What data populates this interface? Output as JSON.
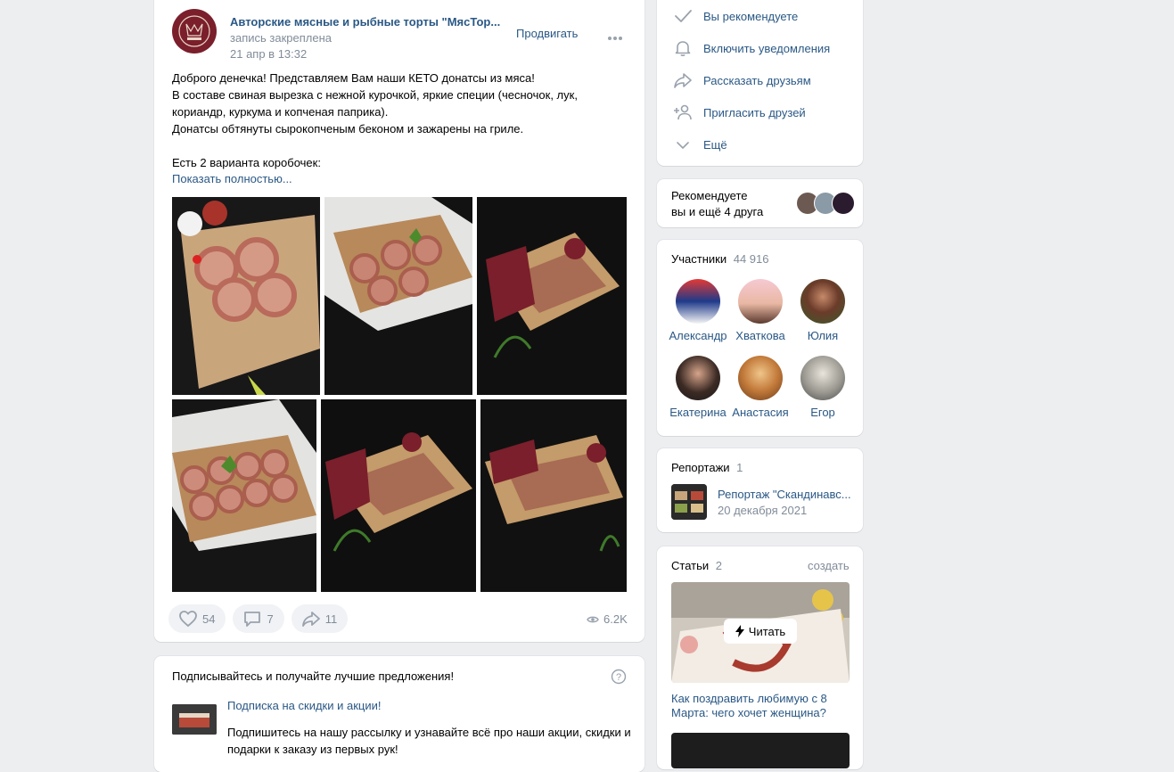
{
  "post": {
    "author": "Авторские мясные и рыбные торты \"МясТор...",
    "pinned": "запись закреплена",
    "date": "21 апр в 13:32",
    "promote": "Продвигать",
    "text_lines": [
      "Доброго денечка! Представляем Вам наши КЕТО донатсы из мяса!",
      "В составе свиная вырезка с нежной курочкой, яркие специи (чесночок, лук,",
      "кориандр, куркума и копченая паприка).",
      "Донатсы обтянуты сырокопченым беконом и зажарены на гриле.",
      "",
      "Есть 2 варианта коробочек:"
    ],
    "show_more": "Показать полностью...",
    "likes": "54",
    "comments": "7",
    "shares": "11",
    "views": "6.2K"
  },
  "subscribe": {
    "title": "Подписывайтесь и получайте лучшие предложения!",
    "item_title": "Подписка на скидки и акции!",
    "item_text_1": "Подпишитесь на нашу рассылку и узнавайте всё про наши акции, скидки и",
    "item_text_2": "подарки к заказу из первых рук!"
  },
  "menu": {
    "items": [
      {
        "label": "Вы рекомендуете",
        "icon": "check-icon"
      },
      {
        "label": "Включить уведомления",
        "icon": "bell-icon"
      },
      {
        "label": "Рассказать друзьям",
        "icon": "share-icon"
      },
      {
        "label": "Пригласить друзей",
        "icon": "add-user-icon"
      },
      {
        "label": "Ещё",
        "icon": "chevron-down-icon"
      }
    ]
  },
  "recommend": {
    "line1": "Рекомендуете",
    "line2": "вы и ещё 4 друга"
  },
  "members": {
    "title": "Участники",
    "count": "44 916",
    "people": [
      {
        "name": "Александр"
      },
      {
        "name": "Хваткова"
      },
      {
        "name": "Юлия"
      },
      {
        "name": "Екатерина"
      },
      {
        "name": "Анастасия"
      },
      {
        "name": "Егор"
      }
    ]
  },
  "reports": {
    "title": "Репортажи",
    "count": "1",
    "item_title": "Репортаж \"Скандинавс...",
    "item_date": "20 декабря 2021"
  },
  "articles": {
    "title": "Статьи",
    "count": "2",
    "create": "создать",
    "read": "Читать",
    "item_title_1": "Как поздравить любимую с 8",
    "item_title_2": "Марта: чего хочет женщина?"
  },
  "colors": {
    "link": "#2a5885",
    "muted": "#818c99",
    "background": "#edeef0",
    "brand": "#7a1f2b"
  }
}
